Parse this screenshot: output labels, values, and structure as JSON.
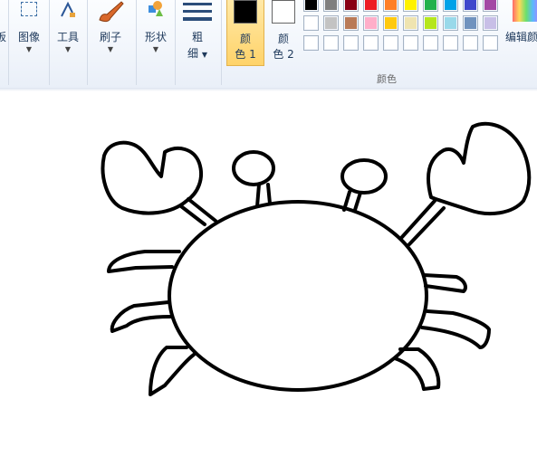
{
  "ribbon": {
    "clipboard_label": "板",
    "image_label": "图像",
    "tools_label": "工具",
    "brushes_label": "刷子",
    "shapes_label": "形状",
    "size_label_1": "粗",
    "size_label_2": "细",
    "color1_line1": "颜",
    "color1_line2": "色 1",
    "color2_line1": "颜",
    "color2_line2": "色 2",
    "colors_group_label": "颜色",
    "edit_colors_label": "编辑颜"
  },
  "colors": {
    "color1": "#000000",
    "color2": "#ffffff",
    "palette_row1": [
      "#000000",
      "#7f7f7f",
      "#880015",
      "#ed1c24",
      "#ff7f27",
      "#fff200",
      "#22b14c",
      "#00a2e8",
      "#3f48cc",
      "#a349a4"
    ],
    "palette_row2": [
      "#ffffff",
      "#c3c3c3",
      "#b97a57",
      "#ffaec9",
      "#ffc90e",
      "#efe4b0",
      "#b5e61d",
      "#99d9ea",
      "#7092be",
      "#c8bfe7"
    ],
    "palette_row3": [
      "#ffffff",
      "#ffffff",
      "#ffffff",
      "#ffffff",
      "#ffffff",
      "#ffffff",
      "#ffffff",
      "#ffffff",
      "#ffffff",
      "#ffffff"
    ]
  },
  "canvas": {
    "drawing": "crab-line-drawing"
  }
}
